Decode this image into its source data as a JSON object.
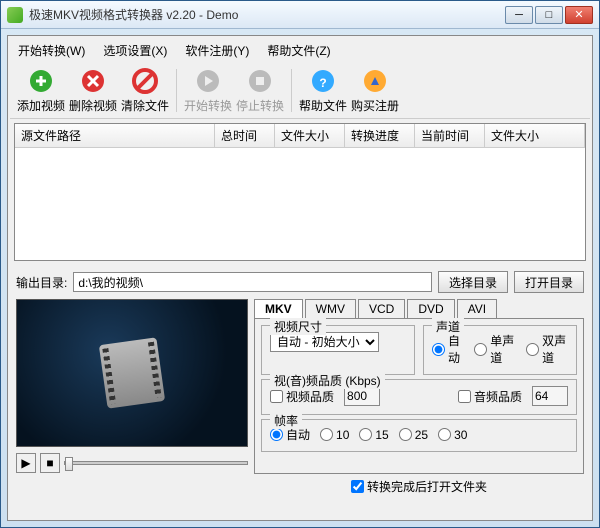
{
  "window": {
    "title": "极速MKV视频格式转换器 v2.20 - Demo"
  },
  "menu": {
    "start": "开始转换(W)",
    "options": "选项设置(X)",
    "register": "软件注册(Y)",
    "help": "帮助文件(Z)"
  },
  "toolbar": {
    "add": "添加视频",
    "delete": "删除视频",
    "clear": "清除文件",
    "start": "开始转换",
    "stop": "停止转换",
    "helpfile": "帮助文件",
    "buy": "购买注册"
  },
  "columns": {
    "source": "源文件路径",
    "totaltime": "总时间",
    "filesize": "文件大小",
    "progress": "转换进度",
    "curtime": "当前时间",
    "outsize": "文件大小"
  },
  "output": {
    "label": "输出目录:",
    "path": "d:\\我的视频\\",
    "choose": "选择目录",
    "open": "打开目录"
  },
  "tabs": {
    "mkv": "MKV",
    "wmv": "WMV",
    "vcd": "VCD",
    "dvd": "DVD",
    "avi": "AVI"
  },
  "settings": {
    "videosize_label": "视频尺寸",
    "videosize_value": "自动 - 初始大小",
    "audio_label": "声道",
    "audio_auto": "自动",
    "audio_mono": "单声道",
    "audio_stereo": "双声道",
    "quality_label": "视(音)频品质 (Kbps)",
    "videoq": "视频品质",
    "videoq_val": "800",
    "audioq": "音频品质",
    "audioq_val": "64",
    "fps_label": "帧率",
    "fps_auto": "自动",
    "fps_10": "10",
    "fps_15": "15",
    "fps_25": "25",
    "fps_30": "30",
    "open_after": "转换完成后打开文件夹"
  }
}
